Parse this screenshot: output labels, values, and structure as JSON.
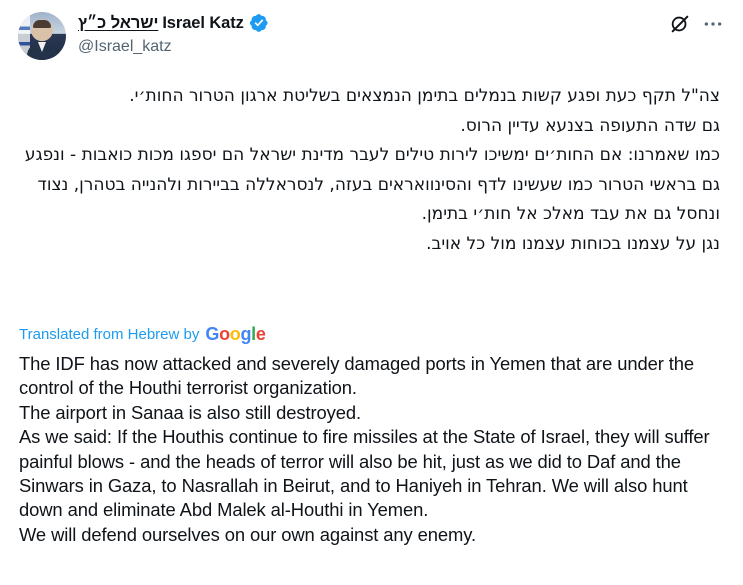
{
  "author": {
    "display_name_hebrew": "ישראל כ״ץ",
    "display_name_english": "Israel Katz",
    "handle": "@Israel_katz",
    "verified_icon": "verified-badge-icon",
    "verified_color": "#1d9bf0"
  },
  "actions": {
    "grok_icon": "grok-icon",
    "more_icon": "more-options-icon"
  },
  "hebrew_lines": [
    "צה\"ל תקף כעת ופגע קשות בנמלים בתימן הנמצאים בשליטת ארגון הטרור החות׳י.",
    "גם שדה התעופה בצנעא עדיין הרוס.",
    "כמו שאמרנו: אם החות׳ים ימשיכו לירות טילים לעבר מדינת ישראל הם יספגו מכות כואבות - ונפגע גם בראשי הטרור כמו שעשינו לדף והסינוואראים בעזה, לנסראללה בביירות ולהנייה בטהרן, נצוד ונחסל גם את עבד מאלכ אל חות׳י בתימן.",
    "נגן על עצמנו בכוחות עצמנו מול כל אויב."
  ],
  "translation": {
    "label": "Translated from Hebrew by",
    "provider": "Google",
    "link_color": "#1d9bf0"
  },
  "english_lines": [
    "The IDF has now attacked and severely damaged ports in Yemen that are under the control of the Houthi terrorist organization.",
    "The airport in Sanaa is also still destroyed.",
    "As we said: If the Houthis continue to fire missiles at the State of Israel, they will suffer painful blows - and the heads of terror will also be hit, just as we did to Daf and the Sinwars in Gaza, to Nasrallah in Beirut, and to Haniyeh in Tehran. We will also hunt down and eliminate Abd Malek al-Houthi in Yemen.",
    "We will defend ourselves on our own against any enemy."
  ]
}
